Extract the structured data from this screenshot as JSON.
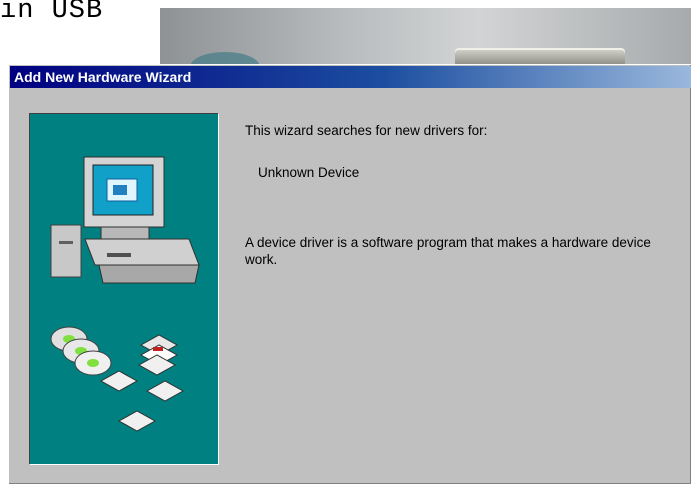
{
  "background_caption": "in USB",
  "window": {
    "title": "Add New Hardware Wizard"
  },
  "wizard": {
    "intro": "This wizard searches for new drivers for:",
    "device_name": "Unknown Device",
    "description": "A device driver is a software program that makes a hardware device work."
  },
  "colors": {
    "titlebar_start": "#000080",
    "titlebar_end": "#9ab8dc",
    "dialog_face": "#c0c0c0",
    "panel_teal": "#008080"
  },
  "icons": [
    "computer-icon",
    "cd-icon",
    "floppy-disk-icon"
  ]
}
